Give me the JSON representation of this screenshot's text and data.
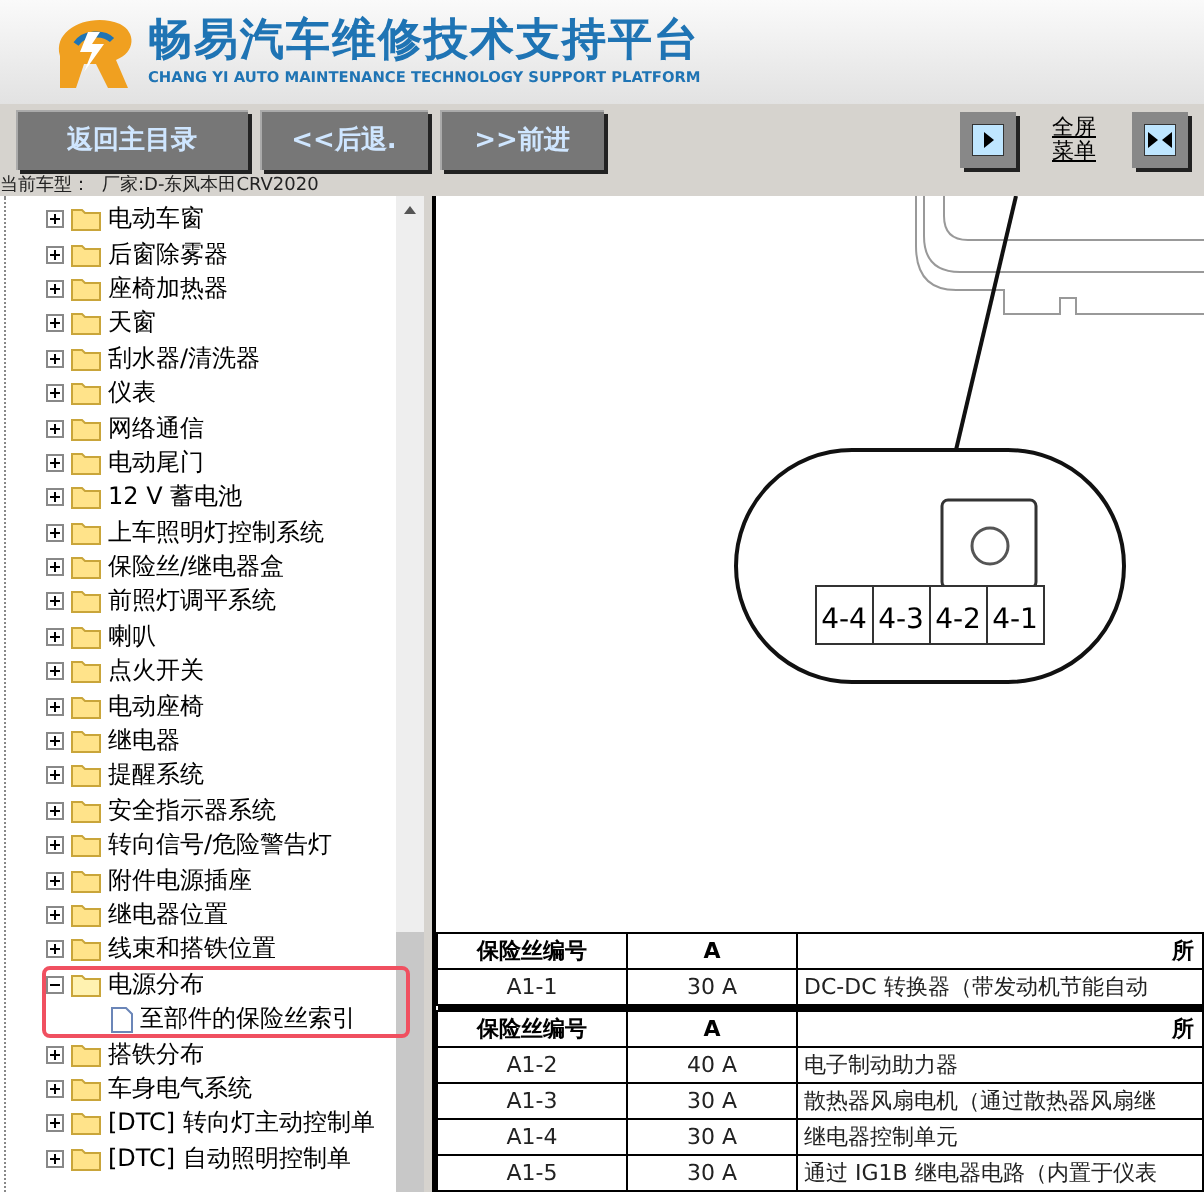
{
  "header": {
    "title": "畅易汽车维修技术支持平台",
    "subtitle": "CHANG YI AUTO MAINTENANCE TECHNOLOGY SUPPORT PLATFORM"
  },
  "toolbar": {
    "buttons": [
      "返回主目录",
      "<<后退.",
      ">>前进"
    ],
    "fullscreen_label": [
      "全屏",
      "菜单"
    ]
  },
  "vehicle_line": {
    "label": "当前车型：",
    "value": "厂家:D-东风本田CRV2020"
  },
  "tree": [
    {
      "label": "电动车窗",
      "expanded": false
    },
    {
      "label": "后窗除雾器",
      "expanded": false
    },
    {
      "label": "座椅加热器",
      "expanded": false
    },
    {
      "label": "天窗",
      "expanded": false
    },
    {
      "label": "刮水器/清洗器",
      "expanded": false
    },
    {
      "label": "仪表",
      "expanded": false
    },
    {
      "label": "网络通信",
      "expanded": false
    },
    {
      "label": "电动尾门",
      "expanded": false
    },
    {
      "label": "12 V 蓄电池",
      "expanded": false
    },
    {
      "label": "上车照明灯控制系统",
      "expanded": false
    },
    {
      "label": "保险丝/继电器盒",
      "expanded": false
    },
    {
      "label": "前照灯调平系统",
      "expanded": false
    },
    {
      "label": "喇叭",
      "expanded": false
    },
    {
      "label": "点火开关",
      "expanded": false
    },
    {
      "label": "电动座椅",
      "expanded": false
    },
    {
      "label": "继电器",
      "expanded": false
    },
    {
      "label": "提醒系统",
      "expanded": false
    },
    {
      "label": "安全指示器系统",
      "expanded": false
    },
    {
      "label": "转向信号/危险警告灯",
      "expanded": false
    },
    {
      "label": "附件电源插座",
      "expanded": false
    },
    {
      "label": "继电器位置",
      "expanded": false
    },
    {
      "label": "线束和搭铁位置",
      "expanded": false
    },
    {
      "label": "电源分布",
      "expanded": true,
      "highlighted": true,
      "children": [
        {
          "label": "至部件的保险丝索引"
        }
      ]
    },
    {
      "label": "搭铁分布",
      "expanded": false
    },
    {
      "label": "车身电气系统",
      "expanded": false
    },
    {
      "label": "[DTC] 转向灯主动控制单",
      "expanded": false
    },
    {
      "label": "[DTC] 自动照明控制单",
      "expanded": false
    }
  ],
  "diagram": {
    "pins": [
      "4-4",
      "4-3",
      "4-2",
      "4-1"
    ]
  },
  "table": {
    "columns": [
      "保险丝编号",
      "A",
      "所"
    ],
    "sections": [
      {
        "rows": [
          [
            "A1-1",
            "30 A",
            "DC-DC 转换器（带发动机节能自动"
          ]
        ]
      },
      {
        "columns": [
          "保险丝编号",
          "A",
          "所"
        ],
        "rows": [
          [
            "A1-2",
            "40 A",
            "电子制动助力器"
          ],
          [
            "A1-3",
            "30 A",
            "散热器风扇电机（通过散热器风扇继"
          ],
          [
            "A1-4",
            "30 A",
            "继电器控制单元"
          ],
          [
            "A1-5",
            "30 A",
            "通过 IG1B 继电器电路（内置于仪表"
          ]
        ]
      }
    ]
  }
}
